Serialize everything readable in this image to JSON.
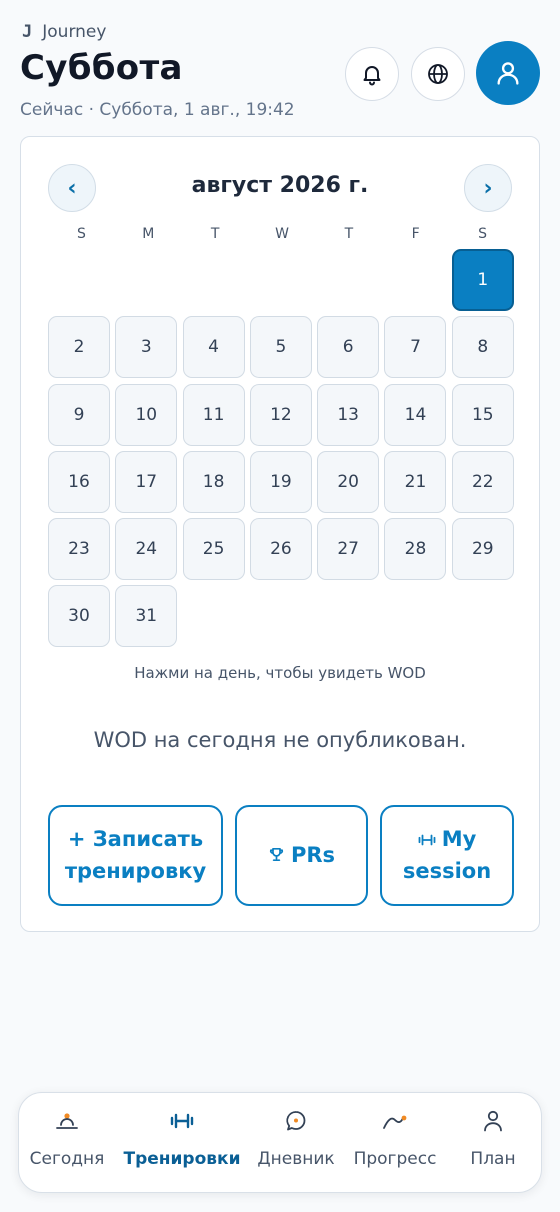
{
  "header": {
    "brand_logo": "J",
    "brand_name": "Journey",
    "title": "Суббота",
    "now": "Сейчас · Суббота, 1 авг., 19:42"
  },
  "calendar": {
    "month_title": "август 2026 г.",
    "prev_label": "‹",
    "next_label": "›",
    "weekdays": [
      "S",
      "M",
      "T",
      "W",
      "T",
      "F",
      "S"
    ],
    "days": [
      "1",
      "2",
      "3",
      "4",
      "5",
      "6",
      "7",
      "8",
      "9",
      "10",
      "11",
      "12",
      "13",
      "14",
      "15",
      "16",
      "17",
      "18",
      "19",
      "20",
      "21",
      "22",
      "23",
      "24",
      "25",
      "26",
      "27",
      "28",
      "29",
      "30",
      "31"
    ],
    "today": "1",
    "hint": "Нажми на день, чтобы увидеть WOD",
    "empty_message": "WOD на сегодня не опубликован."
  },
  "actions": {
    "log_line1": "+ Записать",
    "log_line2": "тренировку",
    "prs_label": "PRs",
    "session_line1": "My",
    "session_line2": "session"
  },
  "bottom_nav": {
    "items": [
      {
        "label": "Сегодня",
        "icon": "sunrise-icon"
      },
      {
        "label": "Тренировки",
        "icon": "dumbbell-icon",
        "active": true
      },
      {
        "label": "Дневник",
        "icon": "chat-bubble-icon"
      },
      {
        "label": "Прогресс",
        "icon": "trend-icon"
      },
      {
        "label": "План",
        "icon": "user-icon"
      }
    ]
  },
  "colors": {
    "accent": "#0a7fc2",
    "accent_dark": "#0a5f95",
    "orange": "#f08a24",
    "background": "#f8fafc"
  }
}
